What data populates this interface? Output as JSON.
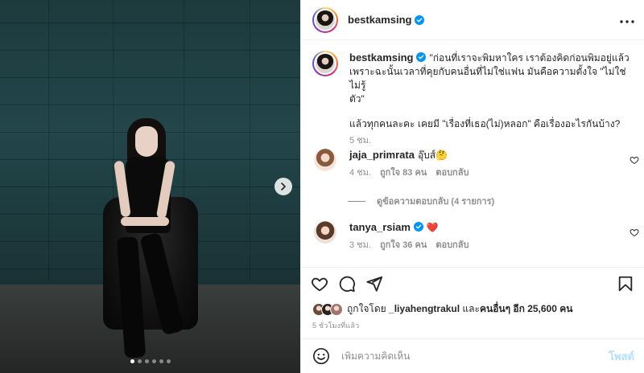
{
  "post": {
    "author": "bestkamsing",
    "verified": true,
    "caption_line1": "\"ก่อนที่เราจะพิมหาใคร เราต้องคิดก่อนพิมอยู่แล้ว",
    "caption_line2": "เพราะฉะนั้นเวลาที่คุยกับคนอื่นที่ไม่ใช่แฟน มันคือความตั้งใจ \"ไม่ใช่ไม่รู้",
    "caption_line3": "ตัว\"",
    "caption_line4": "แล้วทุกคนละคะ เคยมี \"เรื่องที่เธอ(ไม่)หลอก\" คือเรื่องอะไรกันบ้าง?",
    "time": "5 ชม.",
    "carousel": {
      "total": 6,
      "active_index": 0
    }
  },
  "comments": [
    {
      "username": "jaja_primrata",
      "text": "อุ๊บส์🤔",
      "time": "4 ชม.",
      "likes": "ถูกใจ 83 คน",
      "reply": "ตอบกลับ",
      "view_replies": "ดูข้อความตอบกลับ (4 รายการ)"
    },
    {
      "username": "tanya_rsiam",
      "text": "❤️",
      "time": "3 ชม.",
      "likes": "ถูกใจ 36 คน",
      "reply": "ตอบกลับ"
    }
  ],
  "likes_summary": {
    "prefix": "ถูกใจโดย",
    "user": "_liyahengtrakul",
    "middle": "และ",
    "others_label": "คนอื่นๆ อีก 25,600 คน"
  },
  "posted_ago": "5 ชั่วโมงที่แล้ว",
  "composer": {
    "placeholder": "เพิ่มความคิดเห็น",
    "post_label": "โพสต์"
  },
  "colors": {
    "verified": "#0095f6",
    "heart_red": "#ed4956",
    "post_button": "#b2dffc",
    "muted_text": "#8e8e8e"
  },
  "icons": [
    "more-icon",
    "heart-icon",
    "comment-icon",
    "share-icon",
    "save-icon",
    "emoji-icon",
    "next-arrow-icon"
  ]
}
